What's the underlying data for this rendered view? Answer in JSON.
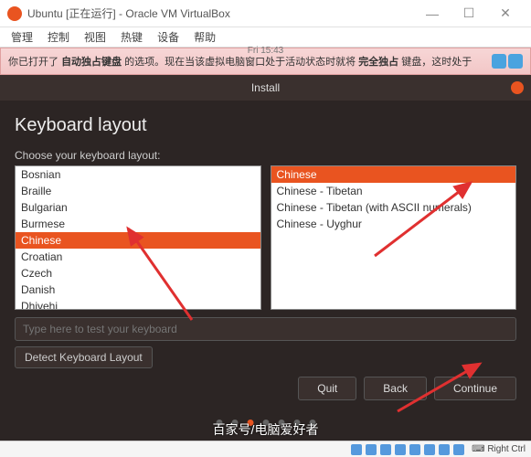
{
  "window": {
    "title": "Ubuntu [正在运行] - Oracle VM VirtualBox",
    "min": "—",
    "max": "☐",
    "close": "✕"
  },
  "menu": {
    "items": [
      "管理",
      "控制",
      "视图",
      "热键",
      "设备",
      "帮助"
    ]
  },
  "notif": {
    "time": "Fri 15:43",
    "text_pre": "你已打开了 ",
    "bold1": "自动独占键盘",
    "text_mid": " 的选项。现在当该虚拟电脑窗口处于活动状态时就将 ",
    "bold2": "完全独占",
    "text_post": " 键盘，这时处于"
  },
  "installer": {
    "titlebar": "Install",
    "heading": "Keyboard layout",
    "choose_label": "Choose your keyboard layout:",
    "left_list": [
      "Bosnian",
      "Braille",
      "Bulgarian",
      "Burmese",
      "Chinese",
      "Croatian",
      "Czech",
      "Danish",
      "Dhivehi"
    ],
    "left_selected": "Chinese",
    "right_list": [
      "Chinese",
      "Chinese - Tibetan",
      "Chinese - Tibetan (with ASCII numerals)",
      "Chinese - Uyghur"
    ],
    "right_selected": "Chinese",
    "test_placeholder": "Type here to test your keyboard",
    "detect_btn": "Detect Keyboard Layout",
    "buttons": {
      "quit": "Quit",
      "back": "Back",
      "continue": "Continue"
    }
  },
  "statusbar": {
    "right_ctrl": "Right Ctrl"
  },
  "watermark": "百家号/电脑爱好者"
}
